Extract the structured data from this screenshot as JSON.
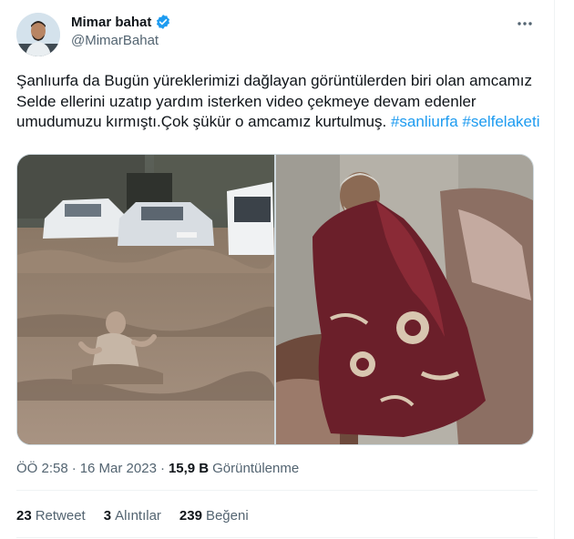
{
  "author": {
    "name": "Mimar bahat",
    "handle": "@MimarBahat"
  },
  "tweet": {
    "text": "Şanlıurfa da Bugün yüreklerimizi dağlayan görüntülerden biri olan amcamız Selde ellerini uzatıp yardım isterken video çekmeye devam edenler umudumuzu kırmıştı.Çok şükür o amcamız kurtulmuş.",
    "hashtags": [
      "#sanliurfa",
      "#selfelaketi"
    ]
  },
  "meta": {
    "time": "ÖÖ 2:58",
    "separator": "·",
    "date": "16 Mar 2023",
    "views_count": "15,9 B",
    "views_label": "Görüntülenme"
  },
  "stats": {
    "retweets_count": "23",
    "retweets_label": "Retweet",
    "quotes_count": "3",
    "quotes_label": "Alıntılar",
    "likes_count": "239",
    "likes_label": "Beğeni"
  },
  "colors": {
    "accent": "#1d9bf0",
    "secondary_text": "#536471",
    "primary_text": "#0f1419"
  },
  "icons": {
    "verified": "verified-badge-icon",
    "more": "more-icon"
  }
}
